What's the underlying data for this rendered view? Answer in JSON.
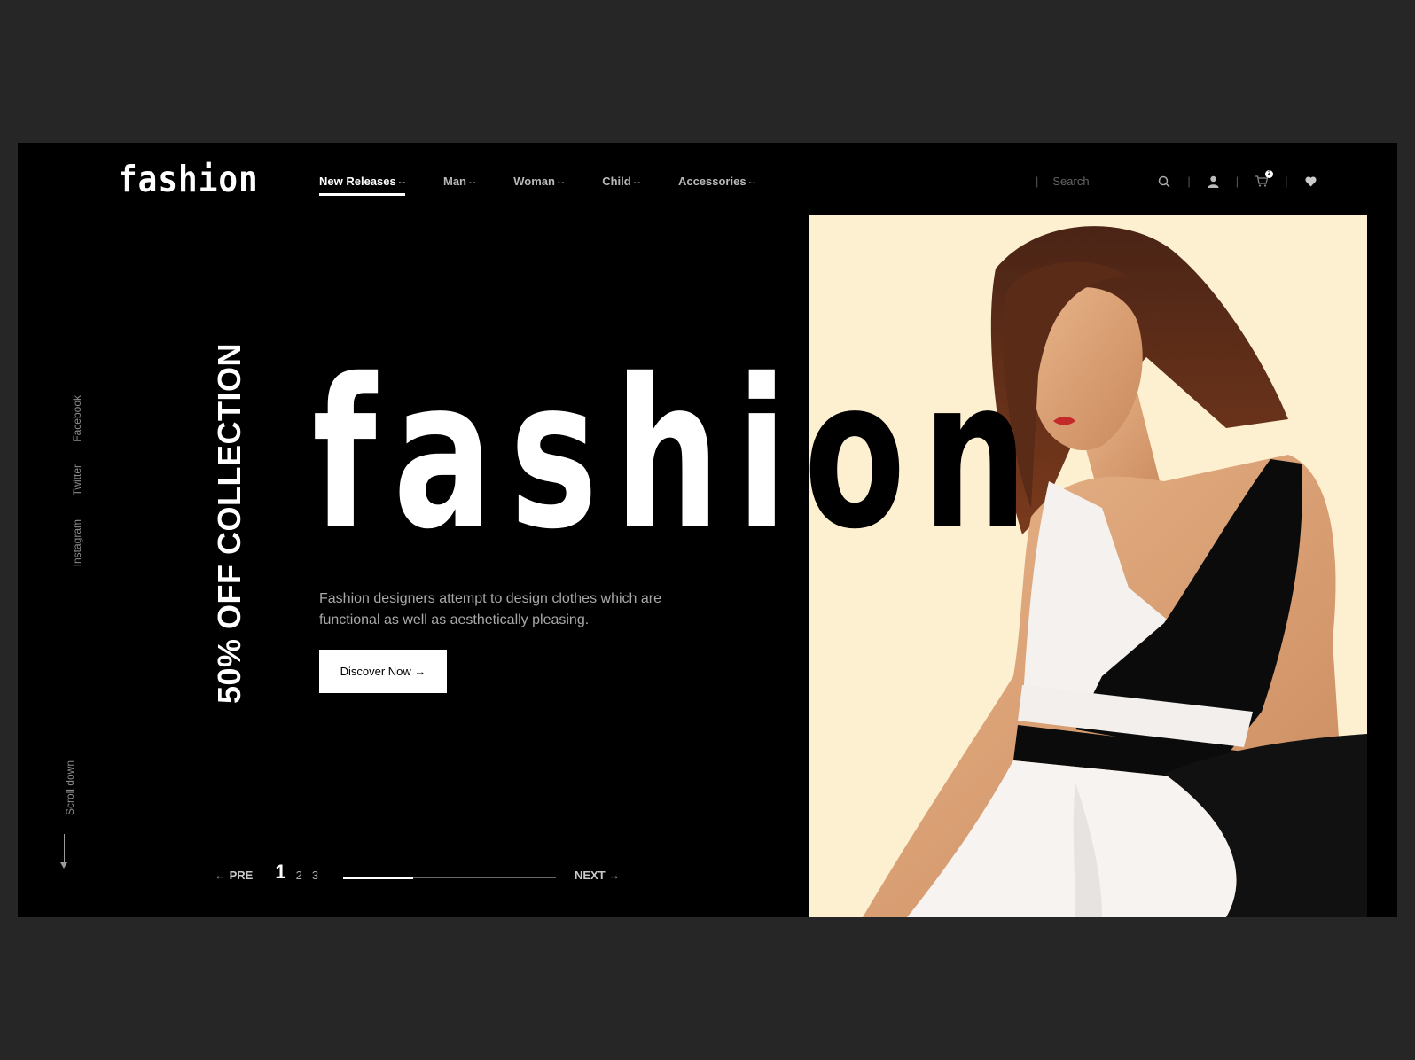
{
  "header": {
    "logo": "fashion",
    "nav": [
      {
        "label": "New Releases",
        "chevron": "⌣",
        "active": true
      },
      {
        "label": "Man",
        "chevron": "⌣",
        "active": false
      },
      {
        "label": "Woman",
        "chevron": "⌣",
        "active": false
      },
      {
        "label": "Child",
        "chevron": "⌣",
        "active": false
      },
      {
        "label": "Accessories",
        "chevron": "⌣",
        "active": false
      }
    ],
    "search_placeholder": "Search",
    "separator": "|",
    "cart_count": "2"
  },
  "social": [
    "Facebook",
    "Twitter",
    "Instagram"
  ],
  "promo": "50% OFF COLLECTION",
  "hero": {
    "title": "fashion",
    "description": "Fashion designers attempt to design clothes which are functional as well as aesthetically pleasing.",
    "cta_label": "Discover Now →"
  },
  "scroll_label": "Scroll down",
  "pager": {
    "prev": "← PRE",
    "pages": [
      "1",
      "2",
      "3"
    ],
    "current": "1",
    "next": "NEXT →",
    "progress": 0.33
  },
  "colors": {
    "background": "#262626",
    "panel": "#000000",
    "image_bg": "#fdf0d1",
    "accent": "#ffffff"
  },
  "icons": [
    "search-icon",
    "user-icon",
    "cart-icon",
    "heart-icon",
    "arrow-down-icon"
  ]
}
